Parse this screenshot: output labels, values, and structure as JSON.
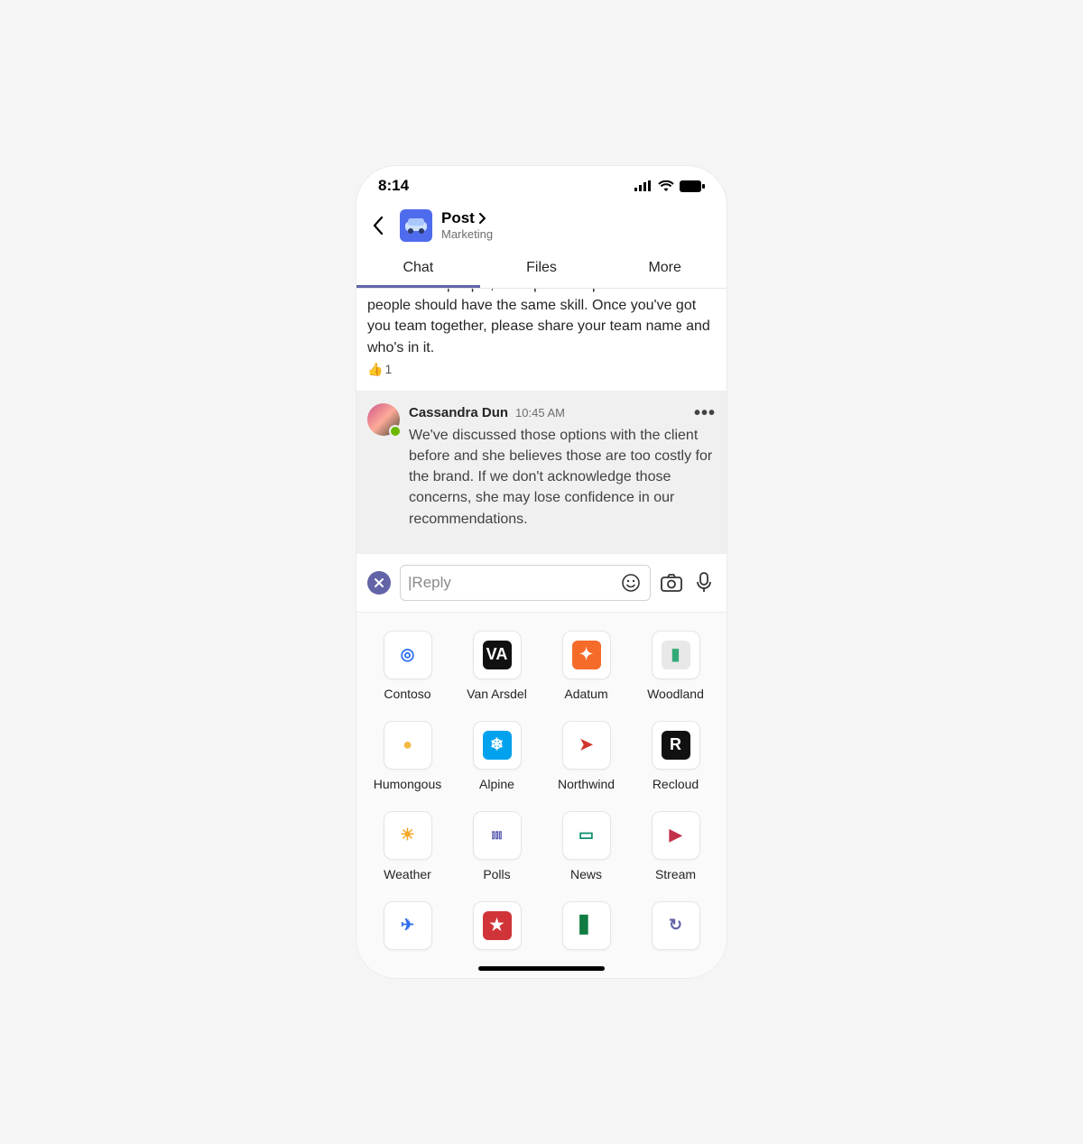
{
  "statusbar": {
    "time": "8:14"
  },
  "header": {
    "title": "Post",
    "subtitle": "Marketing"
  },
  "tabs": [
    "Chat",
    "Files",
    "More"
  ],
  "activeTab": 0,
  "message1": {
    "text": "three to five people, that span multiple skills. No two people should have the same skill. Once you've got you team together, please share your team name and who's in it.",
    "reaction_icon": "👍",
    "reaction_count": "1"
  },
  "message2": {
    "author": "Cassandra Dun",
    "time": "10:45 AM",
    "text": "We've discussed those options with the client before and she believes those are too costly for the brand. If we don't acknowledge those concerns, she may lose confidence in our recommendations."
  },
  "compose": {
    "placeholder": "|Reply"
  },
  "apps": [
    {
      "label": "Contoso",
      "bg": "#ffffff",
      "fg": "#2f6fed",
      "glyph": "◎"
    },
    {
      "label": "Van Arsdel",
      "bg": "#111111",
      "fg": "#ffffff",
      "glyph": "VA"
    },
    {
      "label": "Adatum",
      "bg": "#f56b2a",
      "fg": "#ffffff",
      "glyph": "✦"
    },
    {
      "label": "Woodland",
      "bg": "#e8e8e8",
      "fg": "#3a7",
      "glyph": "▮"
    },
    {
      "label": "Humongous",
      "bg": "#ffffff",
      "fg": "#f5b942",
      "glyph": "●"
    },
    {
      "label": "Alpine",
      "bg": "#00a2ed",
      "fg": "#ffffff",
      "glyph": "❄"
    },
    {
      "label": "Northwind",
      "bg": "#ffffff",
      "fg": "#d0342c",
      "glyph": "➤"
    },
    {
      "label": "Recloud",
      "bg": "#111111",
      "fg": "#ffffff",
      "glyph": "R"
    },
    {
      "label": "Weather",
      "bg": "#ffffff",
      "fg": "#f5a623",
      "glyph": "☀"
    },
    {
      "label": "Polls",
      "bg": "#ffffff",
      "fg": "#5558af",
      "glyph": "⫾⫾⫾"
    },
    {
      "label": "News",
      "bg": "#ffffff",
      "fg": "#0a8f6c",
      "glyph": "▭"
    },
    {
      "label": "Stream",
      "bg": "#ffffff",
      "fg": "#c4314b",
      "glyph": "▶"
    },
    {
      "label": "",
      "bg": "#ffffff",
      "fg": "#2f6fed",
      "glyph": "✈"
    },
    {
      "label": "",
      "bg": "#d13438",
      "fg": "#ffffff",
      "glyph": "★"
    },
    {
      "label": "",
      "bg": "#ffffff",
      "fg": "#107c41",
      "glyph": "▋"
    },
    {
      "label": "",
      "bg": "#ffffff",
      "fg": "#6264a7",
      "glyph": "↻"
    }
  ]
}
